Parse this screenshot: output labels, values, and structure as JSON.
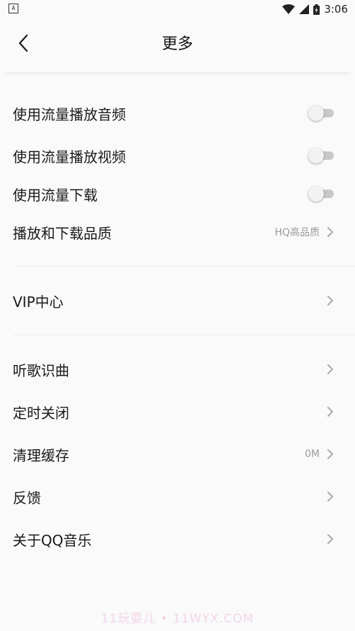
{
  "status_bar": {
    "time": "3:06"
  },
  "header": {
    "title": "更多"
  },
  "section1": [
    {
      "label": "使用流量播放音频",
      "type": "toggle"
    },
    {
      "label": "使用流量播放视频",
      "type": "toggle"
    },
    {
      "label": "使用流量下载",
      "type": "toggle"
    },
    {
      "label": "播放和下载品质",
      "type": "link",
      "value": "HQ高品质"
    }
  ],
  "section2": [
    {
      "label": "VIP中心",
      "type": "link"
    }
  ],
  "section3": [
    {
      "label": "听歌识曲",
      "type": "link"
    },
    {
      "label": "定时关闭",
      "type": "link"
    },
    {
      "label": "清理缓存",
      "type": "link",
      "value": "0M"
    },
    {
      "label": "反馈",
      "type": "link"
    },
    {
      "label": "关于QQ音乐",
      "type": "link"
    }
  ],
  "watermark": "11玩耍儿 • 11WYX.COM"
}
